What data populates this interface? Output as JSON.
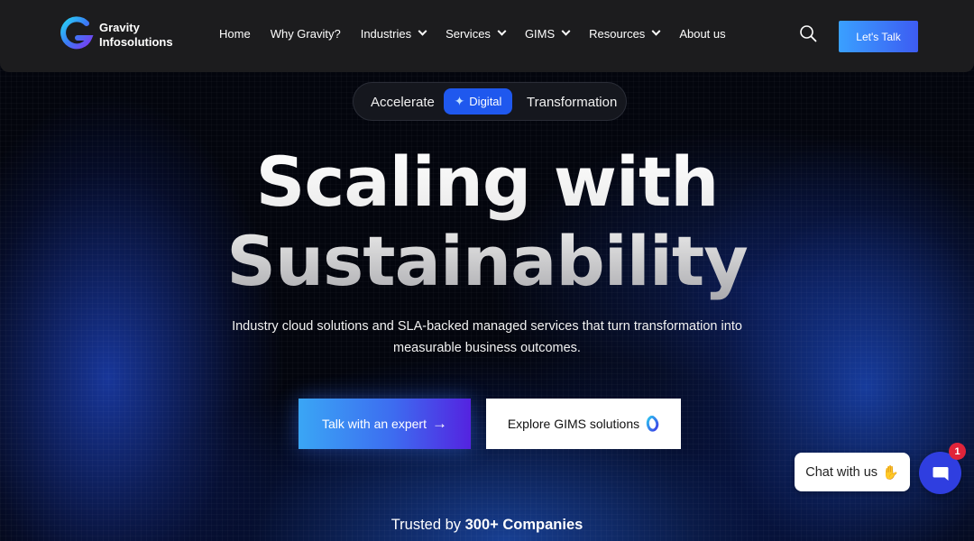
{
  "brand": {
    "line1": "Gravity",
    "line2": "Infosolutions",
    "logo_icon": "gravity-g-logo"
  },
  "nav": {
    "items": [
      {
        "label": "Home",
        "dropdown": false
      },
      {
        "label": "Why Gravity?",
        "dropdown": false
      },
      {
        "label": "Industries",
        "dropdown": true
      },
      {
        "label": "Services",
        "dropdown": true
      },
      {
        "label": "GIMS",
        "dropdown": true
      },
      {
        "label": "Resources",
        "dropdown": true
      },
      {
        "label": "About us",
        "dropdown": false
      }
    ],
    "search_icon": "search-icon",
    "cta_label": "Let's Talk"
  },
  "hero": {
    "pill": {
      "left": "Accelerate",
      "highlight": "Digital",
      "right": "Transformation"
    },
    "headline_line1": "Scaling with",
    "headline_line2": "Sustainability",
    "subtext": "Industry cloud solutions and SLA-backed managed services that turn transformation into measurable business outcomes.",
    "primary_cta": "Talk with an expert",
    "secondary_cta": "Explore GIMS solutions",
    "trusted_prefix": "Trusted by",
    "trusted_count": "300+ Companies"
  },
  "chat": {
    "bubble_label": "Chat with us",
    "badge_count": "1"
  },
  "colors": {
    "accent_blue": "#1f58ee",
    "cta_gradient_start": "#3aa6f5",
    "cta_gradient_end": "#5423e0",
    "navbar_bg": "#1c1c1e",
    "badge_red": "#e0243a"
  }
}
